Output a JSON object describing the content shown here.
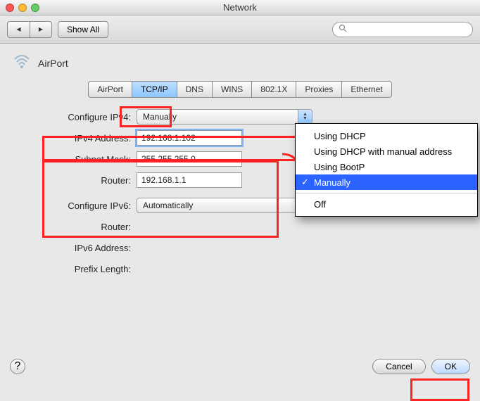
{
  "window": {
    "title": "Network"
  },
  "toolbar": {
    "show_all": "Show All",
    "search_placeholder": "Q"
  },
  "header": {
    "interface_name": "AirPort"
  },
  "tabs": [
    "AirPort",
    "TCP/IP",
    "DNS",
    "WINS",
    "802.1X",
    "Proxies",
    "Ethernet"
  ],
  "active_tab": 1,
  "ipv4": {
    "configure_label": "Configure IPv4:",
    "configure_value": "Manually",
    "address_label": "IPv4 Address:",
    "address_value": "192.168.1.102",
    "mask_label": "Subnet Mask:",
    "mask_value": "255.255.255.0",
    "router_label": "Router:",
    "router_value": "192.168.1.1"
  },
  "ipv6": {
    "configure_label": "Configure IPv6:",
    "configure_value": "Automatically",
    "router_label": "Router:",
    "address_label": "IPv6 Address:",
    "prefix_label": "Prefix Length:"
  },
  "popup": {
    "items": [
      "Using DHCP",
      "Using DHCP with manual address",
      "Using BootP",
      "Manually",
      "Off"
    ],
    "selected": 3
  },
  "footer": {
    "cancel": "Cancel",
    "ok": "OK",
    "help": "?"
  }
}
